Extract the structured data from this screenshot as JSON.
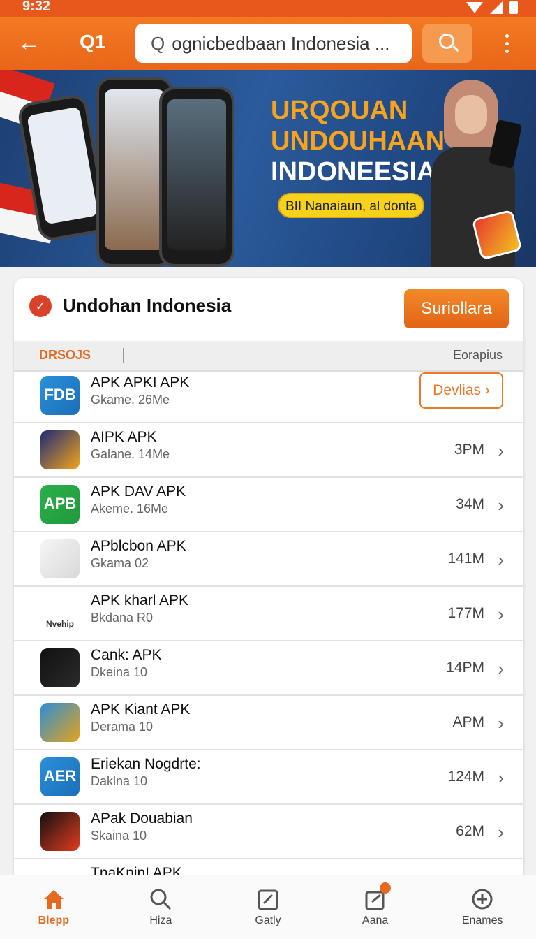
{
  "status_bar": {
    "time": "9:32"
  },
  "app_bar": {
    "back_icon": "arrow-left-icon",
    "label": "Q1",
    "search_value": "ognicbedbaan Indonesia ...",
    "menu_icon": "more-vertical-icon"
  },
  "banner": {
    "headline": [
      "URQOUAN",
      "UNDOUHAAN",
      "INDONEESIA!"
    ],
    "pill": "BII Nanaiaun, al donta"
  },
  "card": {
    "title": "Undohan Indonesia",
    "primary_button": "Suriollara",
    "tab_left": "DRSOJS",
    "tab_right": "Eorapius"
  },
  "apps": [
    {
      "name": "APK APKI APK",
      "sub": "Gkame. 26Me",
      "size": "",
      "action": "Devlias",
      "icon_colors": [
        "#2b8fd8",
        "#1b6fb8"
      ],
      "icon_text": "FDB"
    },
    {
      "name": "AIPK APK",
      "sub": "Galane. 14Me",
      "size": "3PM",
      "action": "",
      "icon_colors": [
        "#1d2a78",
        "#f2a51a"
      ],
      "icon_text": ""
    },
    {
      "name": "APK DAV APK",
      "sub": "Akeme. 16Me",
      "size": "34M",
      "action": "",
      "icon_colors": [
        "#2bb04a",
        "#1f9a3c"
      ],
      "icon_text": "APB"
    },
    {
      "name": "APblcbon APK",
      "sub": "Gkama 02",
      "size": "141M",
      "action": "",
      "icon_colors": [
        "#f5f5f5",
        "#d8d8d8"
      ],
      "icon_text": ""
    },
    {
      "name": "APK kharl APK",
      "sub": "Bkdana R0",
      "size": "177M",
      "action": "",
      "icon_colors": [
        "#ffffff",
        "#ffffff"
      ],
      "icon_text": "Nvehip"
    },
    {
      "name": "Cank: APK",
      "sub": "Dkeina 10",
      "size": "14PM",
      "action": "",
      "icon_colors": [
        "#111111",
        "#2b2b2b"
      ],
      "icon_text": ""
    },
    {
      "name": "APK Kiant APK",
      "sub": "Derama 10",
      "size": "APM",
      "action": "",
      "icon_colors": [
        "#2b8fd8",
        "#e6a21a"
      ],
      "icon_text": ""
    },
    {
      "name": "Eriekan Nogdrte:",
      "sub": "Daklna 10",
      "size": "124M",
      "action": "",
      "icon_colors": [
        "#2b8fd8",
        "#1b6fb8"
      ],
      "icon_text": "AER"
    },
    {
      "name": "APak Douabian",
      "sub": "Skaina 10",
      "size": "62M",
      "action": "",
      "icon_colors": [
        "#111111",
        "#e23b1f"
      ],
      "icon_text": ""
    },
    {
      "name": "TnaKnin! APK",
      "sub": "",
      "size": "",
      "action": "",
      "icon_colors": [
        "#ffffff",
        "#ffffff"
      ],
      "icon_text": ""
    }
  ],
  "bottom_nav": [
    {
      "label": "Blepp",
      "icon": "home-icon",
      "active": true
    },
    {
      "label": "Hiza",
      "icon": "search-icon",
      "active": false
    },
    {
      "label": "Gatly",
      "icon": "edit-icon",
      "active": false
    },
    {
      "label": "Aana",
      "icon": "share-icon",
      "active": false
    },
    {
      "label": "Enames",
      "icon": "plus-circle-icon",
      "active": false
    }
  ],
  "colors": {
    "accent": "#e9661a",
    "banner": "#2b5b9c"
  }
}
